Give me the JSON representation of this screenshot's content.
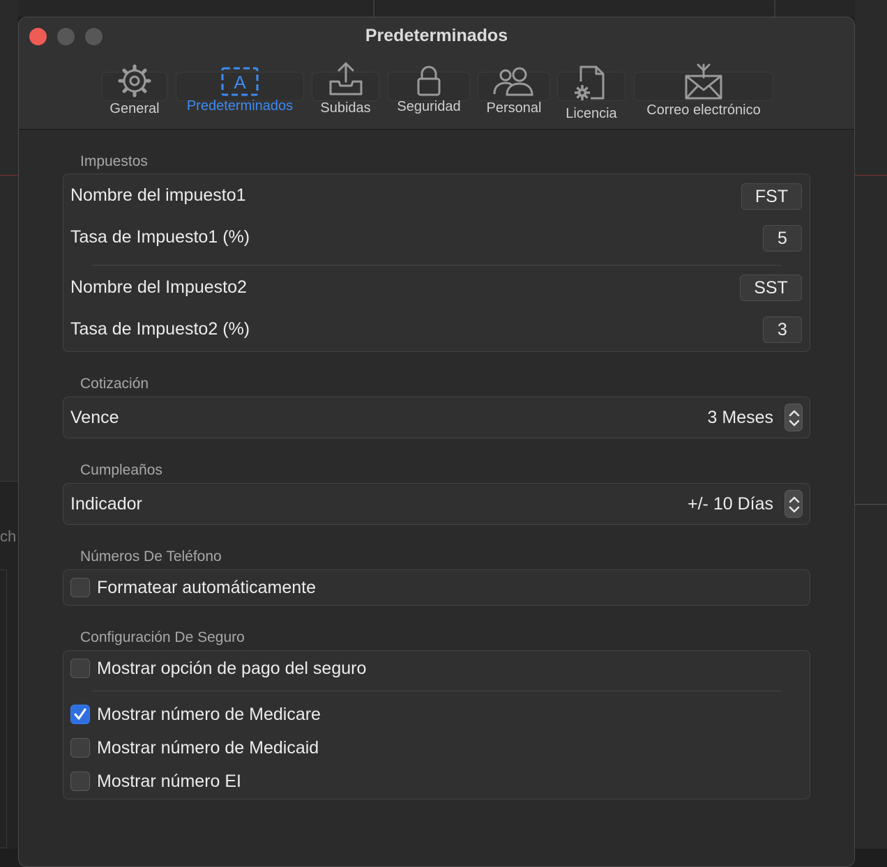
{
  "window": {
    "title": "Predeterminados"
  },
  "toolbar": {
    "tabs": [
      {
        "label": "General",
        "icon": "gear-icon"
      },
      {
        "label": "Predeterminados",
        "icon": "text-box-icon"
      },
      {
        "label": "Subidas",
        "icon": "upload-tray-icon"
      },
      {
        "label": "Seguridad",
        "icon": "lock-icon"
      },
      {
        "label": "Personal",
        "icon": "people-icon"
      },
      {
        "label": "Licencia",
        "icon": "document-gear-icon"
      },
      {
        "label": "Correo electrónico",
        "icon": "envelope-icon"
      }
    ],
    "active_tab": "Predeterminados"
  },
  "taxes": {
    "section_title": "Impuestos",
    "tax1_name_label": "Nombre del impuesto1",
    "tax1_name_value": "FST",
    "tax1_rate_label": "Tasa de Impuesto1 (%)",
    "tax1_rate_value": "5",
    "tax2_name_label": "Nombre del Impuesto2",
    "tax2_name_value": "SST",
    "tax2_rate_label": "Tasa de Impuesto2 (%)",
    "tax2_rate_value": "3"
  },
  "quote": {
    "section_title": "Cotización",
    "expires_label": "Vence",
    "expires_value": "3 Meses"
  },
  "birthdays": {
    "section_title": "Cumpleaños",
    "indicator_label": "Indicador",
    "indicator_value": "+/- 10 Días"
  },
  "phones": {
    "section_title": "Números De Teléfono",
    "autoformat_label": "Formatear automáticamente",
    "autoformat_checked": false
  },
  "insurance": {
    "section_title": "Configuración De Seguro",
    "options": [
      {
        "label": "Mostrar opción de pago del seguro",
        "checked": false
      },
      {
        "label": "Mostrar número de Medicare",
        "checked": true
      },
      {
        "label": "Mostrar número de Medicaid",
        "checked": false
      },
      {
        "label": "Mostrar número EI",
        "checked": false
      }
    ]
  },
  "colors": {
    "accent": "#3d8bf2",
    "close": "#ee5c56",
    "checkbox_checked": "#2f6fe0"
  },
  "background": {
    "partial_text": "ch"
  }
}
